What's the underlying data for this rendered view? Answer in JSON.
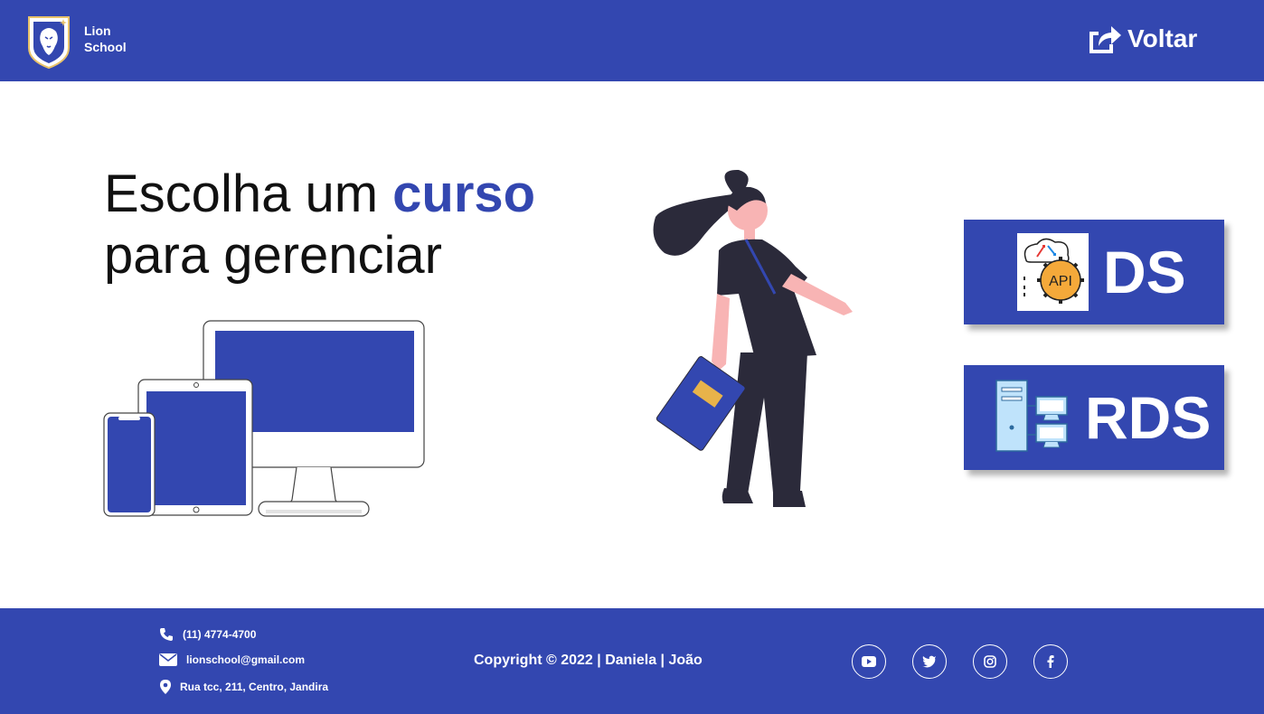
{
  "header": {
    "brand_line1": "Lion",
    "brand_line2": "School",
    "back_label": "Voltar"
  },
  "main": {
    "title_part1": "Escolha um ",
    "title_accent": "curso",
    "title_part2": "para gerenciar",
    "courses": [
      {
        "label": "DS",
        "icon": "api-gear-icon"
      },
      {
        "label": "RDS",
        "icon": "network-servers-icon"
      }
    ]
  },
  "footer": {
    "phone": "(11) 4774-4700",
    "email": "lionschool@gmail.com",
    "address": "Rua tcc, 211, Centro, Jandira",
    "copyright": "Copyright © 2022 | Daniela | João",
    "social": [
      "youtube-icon",
      "twitter-icon",
      "instagram-icon",
      "facebook-icon"
    ]
  },
  "colors": {
    "primary": "#3347B0",
    "text": "#111111",
    "white": "#ffffff"
  }
}
